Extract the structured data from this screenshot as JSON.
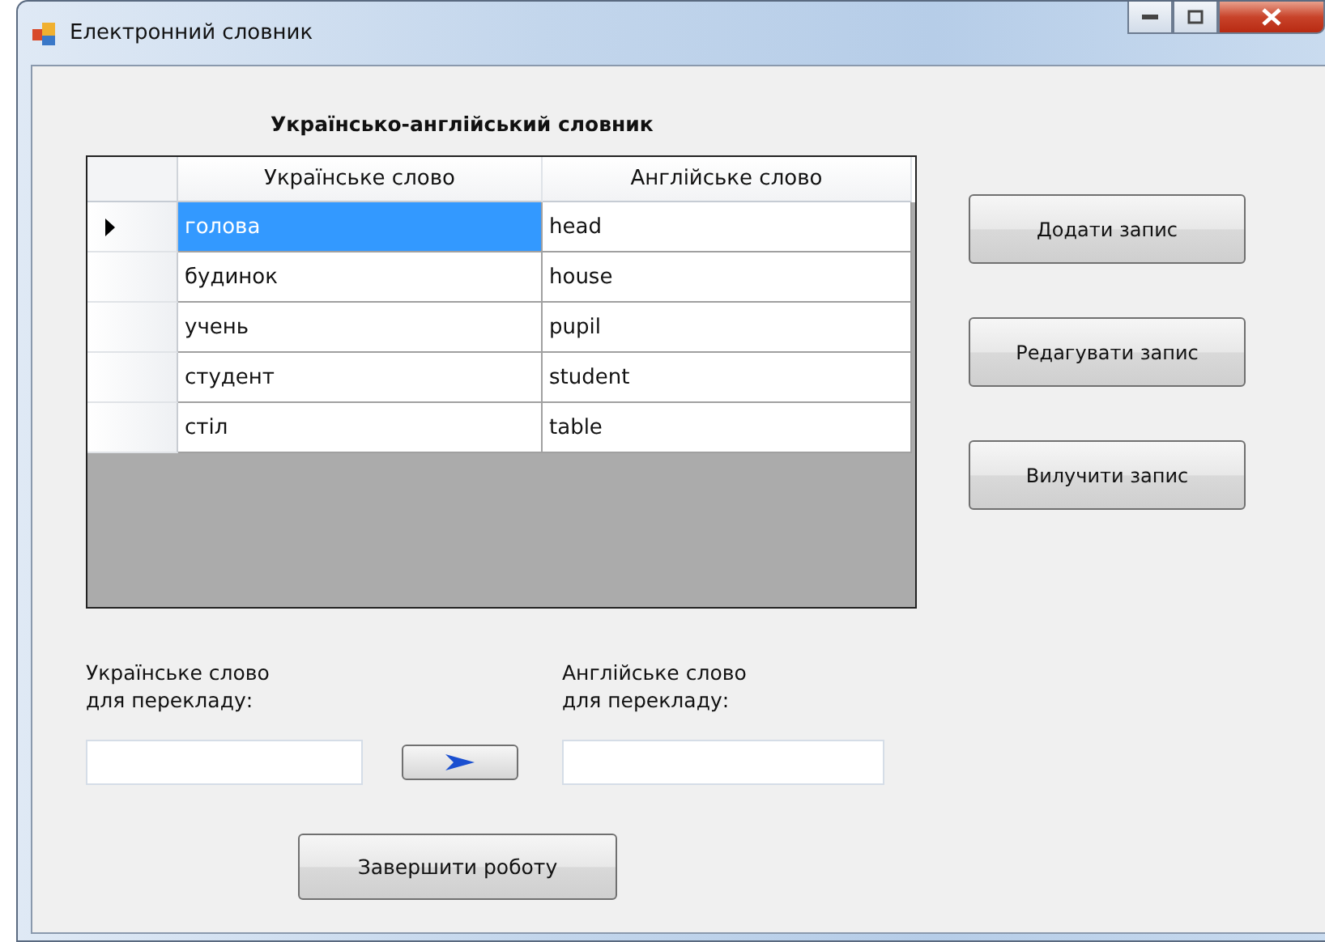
{
  "window": {
    "title": "Електронний словник"
  },
  "grid": {
    "title": "Українсько-англійський словник",
    "columns": [
      "Українське слово",
      "Англійське слово"
    ],
    "rows": [
      {
        "cells": [
          "голова",
          "head"
        ],
        "selected": true
      },
      {
        "cells": [
          "будинок",
          "house"
        ],
        "selected": false
      },
      {
        "cells": [
          "учень",
          "pupil"
        ],
        "selected": false
      },
      {
        "cells": [
          "студент",
          "student"
        ],
        "selected": false
      },
      {
        "cells": [
          "стіл",
          "table"
        ],
        "selected": false
      }
    ]
  },
  "side_buttons": [
    "Додати запис",
    "Редагувати запис",
    "Вилучити запис"
  ],
  "source": {
    "label": "Українське слово\nдля перекладу:"
  },
  "target": {
    "label": "Англійське слово\nдля перекладу:"
  },
  "finish_button": "Завершити роботу"
}
